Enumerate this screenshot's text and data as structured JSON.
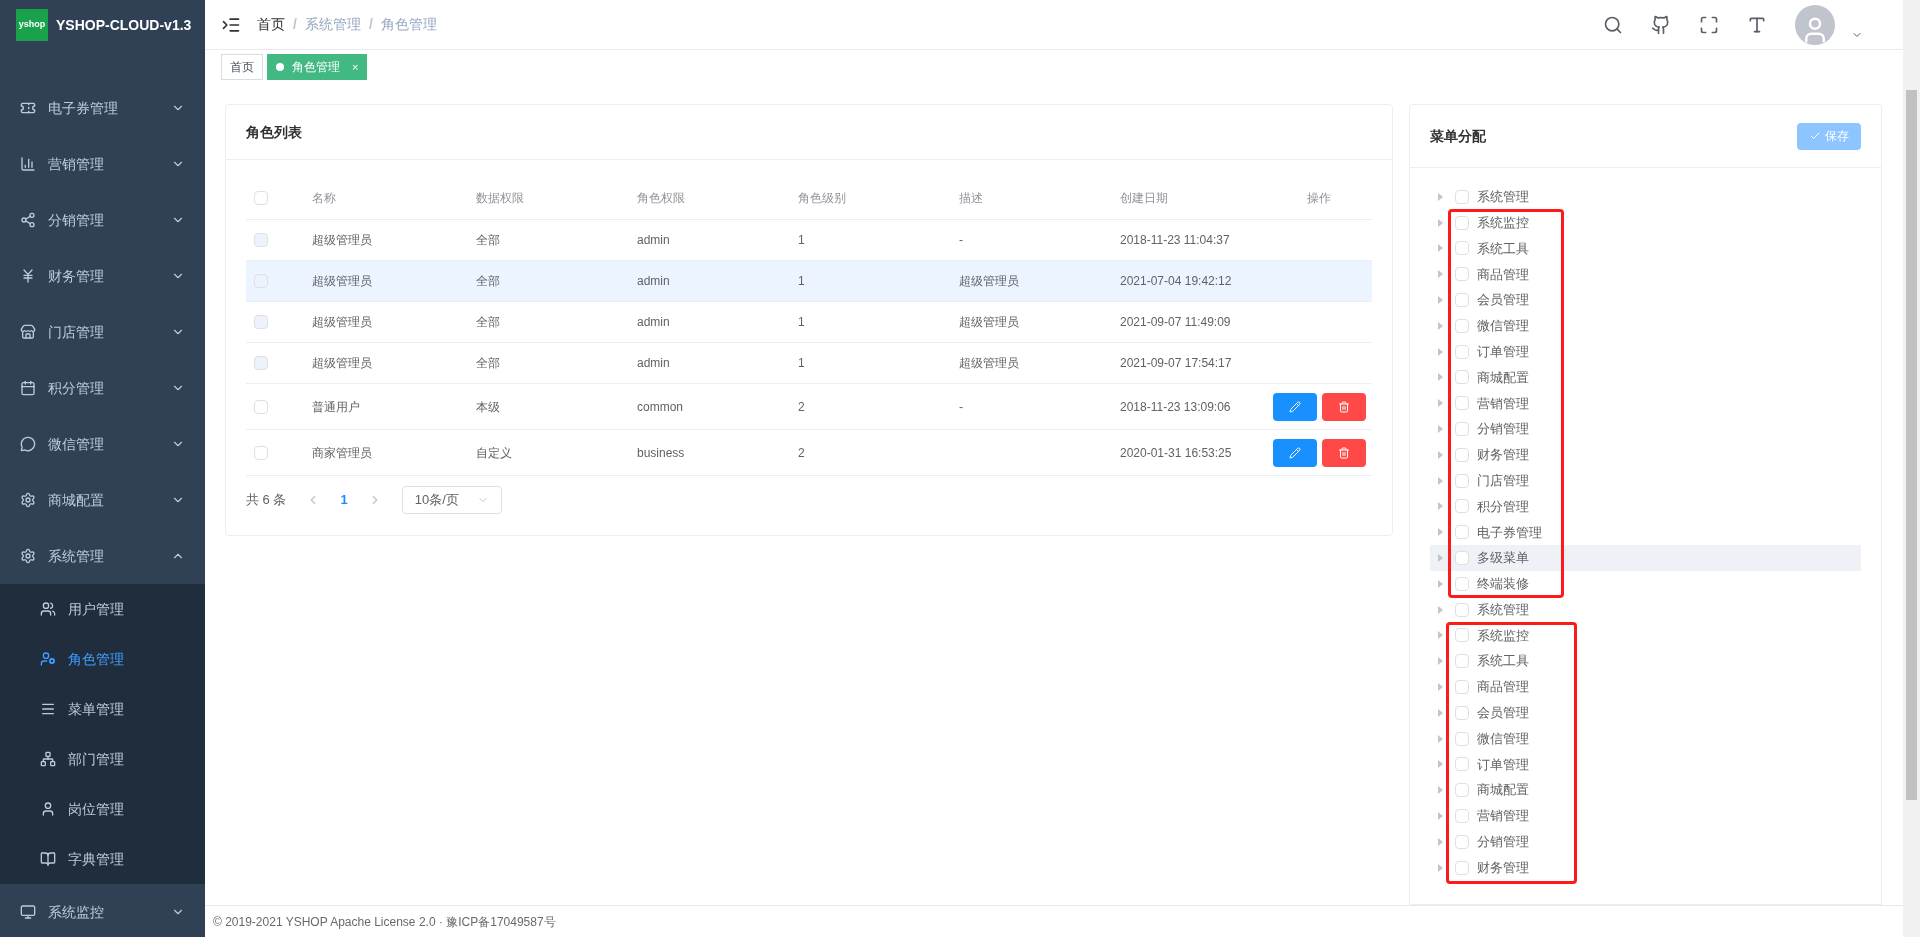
{
  "logo": {
    "mark": "yshop",
    "title": "YSHOP-CLOUD-v1.3"
  },
  "sidebar": {
    "items": [
      {
        "label": "电子券管理",
        "expanded": false
      },
      {
        "label": "营销管理",
        "expanded": false
      },
      {
        "label": "分销管理",
        "expanded": false
      },
      {
        "label": "财务管理",
        "expanded": false
      },
      {
        "label": "门店管理",
        "expanded": false
      },
      {
        "label": "积分管理",
        "expanded": false
      },
      {
        "label": "微信管理",
        "expanded": false
      },
      {
        "label": "商城配置",
        "expanded": false
      },
      {
        "label": "系统管理",
        "expanded": true,
        "children": [
          {
            "label": "用户管理",
            "selected": false
          },
          {
            "label": "角色管理",
            "selected": true
          },
          {
            "label": "菜单管理",
            "selected": false
          },
          {
            "label": "部门管理",
            "selected": false
          },
          {
            "label": "岗位管理",
            "selected": false
          },
          {
            "label": "字典管理",
            "selected": false
          }
        ]
      },
      {
        "label": "系统监控",
        "expanded": false
      }
    ]
  },
  "breadcrumb": {
    "items": [
      "首页",
      "系统管理",
      "角色管理"
    ],
    "separators": [
      "/",
      "/"
    ]
  },
  "tags": [
    {
      "label": "首页",
      "selected": false
    },
    {
      "label": "角色管理",
      "selected": true,
      "close": "×"
    }
  ],
  "role_list": {
    "title": "角色列表",
    "select_all": {
      "checked": false
    },
    "columns": [
      "名称",
      "数据权限",
      "角色权限",
      "角色级别",
      "描述",
      "创建日期",
      "操作"
    ],
    "rows": [
      {
        "name": "超级管理员",
        "data_scope": "全部",
        "permission": "admin",
        "level_text": "1",
        "description": "-",
        "created": "2018-11-23 11:04:37",
        "disabled": true,
        "hovered": false,
        "actions": false
      },
      {
        "name": "超级管理员",
        "data_scope": "全部",
        "permission": "admin",
        "level_text": "1",
        "description": "超级管理员",
        "created": "2021-07-04 19:42:12",
        "disabled": true,
        "hovered": true,
        "actions": false
      },
      {
        "name": "超级管理员",
        "data_scope": "全部",
        "permission": "admin",
        "level_text": "1",
        "description": "超级管理员",
        "created": "2021-09-07 11:49:09",
        "disabled": true,
        "hovered": false,
        "actions": false
      },
      {
        "name": "超级管理员",
        "data_scope": "全部",
        "permission": "admin",
        "level_text": "1",
        "description": "超级管理员",
        "created": "2021-09-07 17:54:17",
        "disabled": true,
        "hovered": false,
        "actions": false
      },
      {
        "name": "普通用户",
        "data_scope": "本级",
        "permission": "common",
        "level_text": "2",
        "description": "-",
        "created": "2018-11-23 13:09:06",
        "disabled": false,
        "hovered": false,
        "actions": true
      },
      {
        "name": "商家管理员",
        "data_scope": "自定义",
        "permission": "business",
        "level_text": "2",
        "created": "2020-01-31 16:53:25",
        "disabled": false,
        "hovered": false,
        "actions": true
      }
    ],
    "pagination": {
      "total": "共 6 条",
      "pages": [
        {
          "label": "1",
          "selected": true
        }
      ],
      "page_size": "10条/页"
    }
  },
  "menu_assign": {
    "title": "菜单分配",
    "save": {
      "label": "保存",
      "disabled": true
    },
    "tree": [
      {
        "label": "系统管理",
        "checked": false,
        "hovered": false
      },
      {
        "label": "系统监控",
        "checked": false,
        "hovered": false
      },
      {
        "label": "系统工具",
        "checked": false,
        "hovered": false
      },
      {
        "label": "商品管理",
        "checked": false,
        "hovered": false
      },
      {
        "label": "会员管理",
        "checked": false,
        "hovered": false
      },
      {
        "label": "微信管理",
        "checked": false,
        "hovered": false
      },
      {
        "label": "订单管理",
        "checked": false,
        "hovered": false
      },
      {
        "label": "商城配置",
        "checked": false,
        "hovered": false
      },
      {
        "label": "营销管理",
        "checked": false,
        "hovered": false
      },
      {
        "label": "分销管理",
        "checked": false,
        "hovered": false
      },
      {
        "label": "财务管理",
        "checked": false,
        "hovered": false
      },
      {
        "label": "门店管理",
        "checked": false,
        "hovered": false
      },
      {
        "label": "积分管理",
        "checked": false,
        "hovered": false
      },
      {
        "label": "电子券管理",
        "checked": false,
        "hovered": false
      },
      {
        "label": "多级菜单",
        "checked": false,
        "hovered": true
      },
      {
        "label": "终端装修",
        "checked": false,
        "hovered": false
      },
      {
        "label": "系统管理",
        "checked": false,
        "hovered": false
      },
      {
        "label": "系统监控",
        "checked": false,
        "hovered": false
      },
      {
        "label": "系统工具",
        "checked": false,
        "hovered": false
      },
      {
        "label": "商品管理",
        "checked": false,
        "hovered": false
      },
      {
        "label": "会员管理",
        "checked": false,
        "hovered": false
      },
      {
        "label": "微信管理",
        "checked": false,
        "hovered": false
      },
      {
        "label": "订单管理",
        "checked": false,
        "hovered": false
      },
      {
        "label": "商城配置",
        "checked": false,
        "hovered": false
      },
      {
        "label": "营销管理",
        "checked": false,
        "hovered": false
      },
      {
        "label": "分销管理",
        "checked": false,
        "hovered": false
      },
      {
        "label": "财务管理",
        "checked": false,
        "hovered": false
      }
    ]
  },
  "footer": {
    "text": "© 2019-2021 YSHOP Apache License 2.0 · 豫ICP备17049587号"
  }
}
